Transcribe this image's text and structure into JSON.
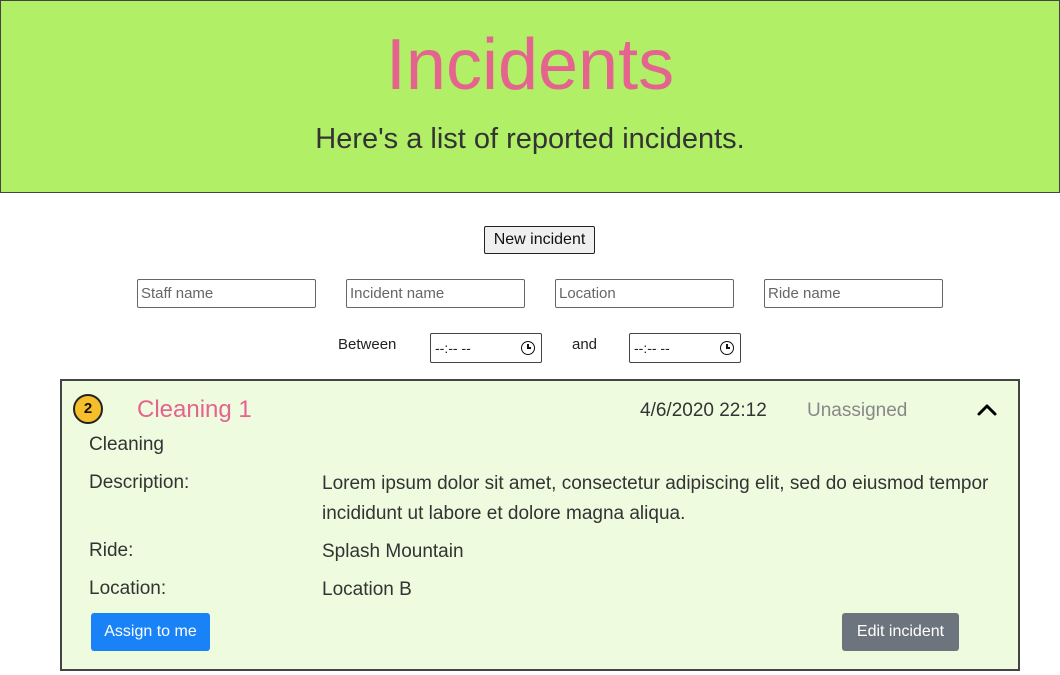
{
  "header": {
    "title": "Incidents",
    "subtitle": "Here's a list of reported incidents."
  },
  "toolbar": {
    "new_incident_label": "New incident"
  },
  "filters": {
    "staff_placeholder": "Staff name",
    "incident_placeholder": "Incident name",
    "location_placeholder": "Location",
    "ride_placeholder": "Ride name",
    "between_label": "Between",
    "and_label": "and",
    "time_from_value": "--:-- --",
    "time_to_value": "--:-- --"
  },
  "incident": {
    "priority": "2",
    "title": "Cleaning 1",
    "datetime": "4/6/2020 22:12",
    "status": "Unassigned",
    "type": "Cleaning",
    "description_label": "Description:",
    "description": "Lorem ipsum dolor sit amet, consectetur adipiscing elit, sed do eiusmod tempor incididunt ut labore et dolore magna aliqua.",
    "ride_label": "Ride:",
    "ride": "Splash Mountain",
    "location_label": "Location:",
    "location": "Location B",
    "assign_label": "Assign to me",
    "edit_label": "Edit incident"
  },
  "colors": {
    "header_bg": "#b1ef66",
    "title_pink": "#e5638f",
    "card_bg": "#eefbdf",
    "badge_yellow": "#f7be2c",
    "assign_blue": "#1a82f7",
    "edit_gray": "#6c757d"
  },
  "icons": {
    "collapse": "chevron-up-icon",
    "clock": "clock-icon"
  }
}
